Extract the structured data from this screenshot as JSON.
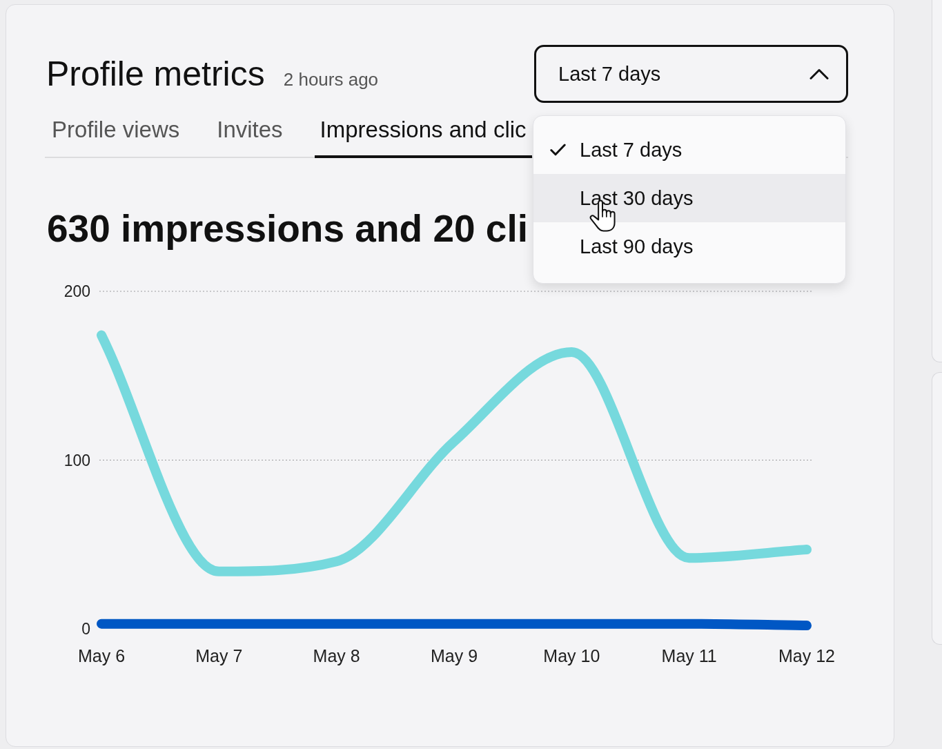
{
  "header": {
    "title": "Profile metrics",
    "updated": "2 hours ago"
  },
  "range_select": {
    "value": "Last 7 days",
    "expanded": true,
    "options": [
      {
        "label": "Last 7 days",
        "selected": true,
        "highlighted": false
      },
      {
        "label": "Last 30 days",
        "selected": false,
        "highlighted": true
      },
      {
        "label": "Last 90 days",
        "selected": false,
        "highlighted": false
      }
    ]
  },
  "tabs": [
    {
      "label": "Profile views",
      "selected": false
    },
    {
      "label": "Invites",
      "selected": false
    },
    {
      "label": "Impressions and clic",
      "selected": true
    }
  ],
  "summary": "630 impressions and 20 cli",
  "chart": {
    "chart_data": {
      "type": "line",
      "categories": [
        "May 6",
        "May 7",
        "May 8",
        "May 9",
        "May 10",
        "May 11",
        "May 12"
      ],
      "series": [
        {
          "color": "#76d9dd",
          "values": [
            174,
            34,
            40,
            111,
            164,
            42,
            47
          ]
        },
        {
          "color": "#0057c4",
          "values": [
            3,
            3,
            3,
            3,
            3,
            3,
            2
          ]
        }
      ],
      "ylim": [
        0,
        200
      ],
      "yticks": [
        0,
        100,
        200
      ]
    }
  }
}
